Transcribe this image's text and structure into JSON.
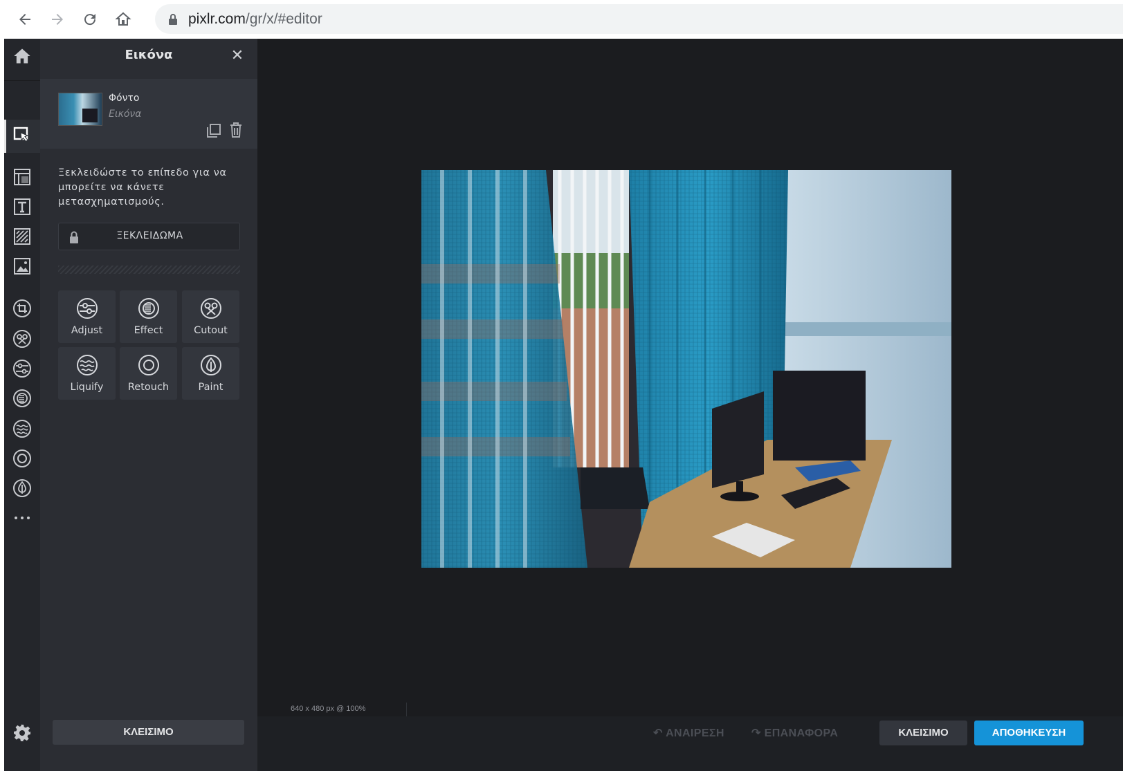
{
  "browser": {
    "url_host": "pixlr.com",
    "url_path": "/gr/x/#editor"
  },
  "panel": {
    "title": "Εικόνα",
    "layer": {
      "name": "Φόντο",
      "type": "Εικόνα"
    },
    "unlock_message": "Ξεκλειδώστε το επίπεδο για να μπορείτε να κάνετε μετασχηματισμούς.",
    "unlock_button": "ΞΕΚΛΕΙΔΩΜΑ",
    "tools": [
      {
        "label": "Adjust",
        "icon": "adjust-icon"
      },
      {
        "label": "Effect",
        "icon": "effect-icon"
      },
      {
        "label": "Cutout",
        "icon": "cutout-icon"
      },
      {
        "label": "Liquify",
        "icon": "liquify-icon"
      },
      {
        "label": "Retouch",
        "icon": "retouch-icon"
      },
      {
        "label": "Paint",
        "icon": "paint-icon"
      }
    ],
    "close_button": "ΚΛΕΙΣΙΜΟ"
  },
  "rail": {
    "icons": [
      "home-icon",
      "arrange-tool-icon",
      "layout-icon",
      "text-icon",
      "pattern-icon",
      "image-icon",
      "crop-icon",
      "cutout-icon",
      "adjust-icon",
      "effect-icon",
      "liquify-icon",
      "retouch-icon",
      "paint-icon",
      "more-icon",
      "settings-icon"
    ]
  },
  "status": {
    "text": "640 x 480 px @ 100%"
  },
  "bottom": {
    "undo": "ΑΝΑΙΡΕΣΗ",
    "redo": "ΕΠΑΝΑΦΟΡΑ",
    "close": "ΚΛΕΙΣΙΜΟ",
    "save": "ΑΠΟΘΗΚΕΥΣΗ"
  },
  "colors": {
    "accent": "#1593d8",
    "app_bg": "#1b1c1f",
    "panel_bg": "#2b2d33"
  }
}
